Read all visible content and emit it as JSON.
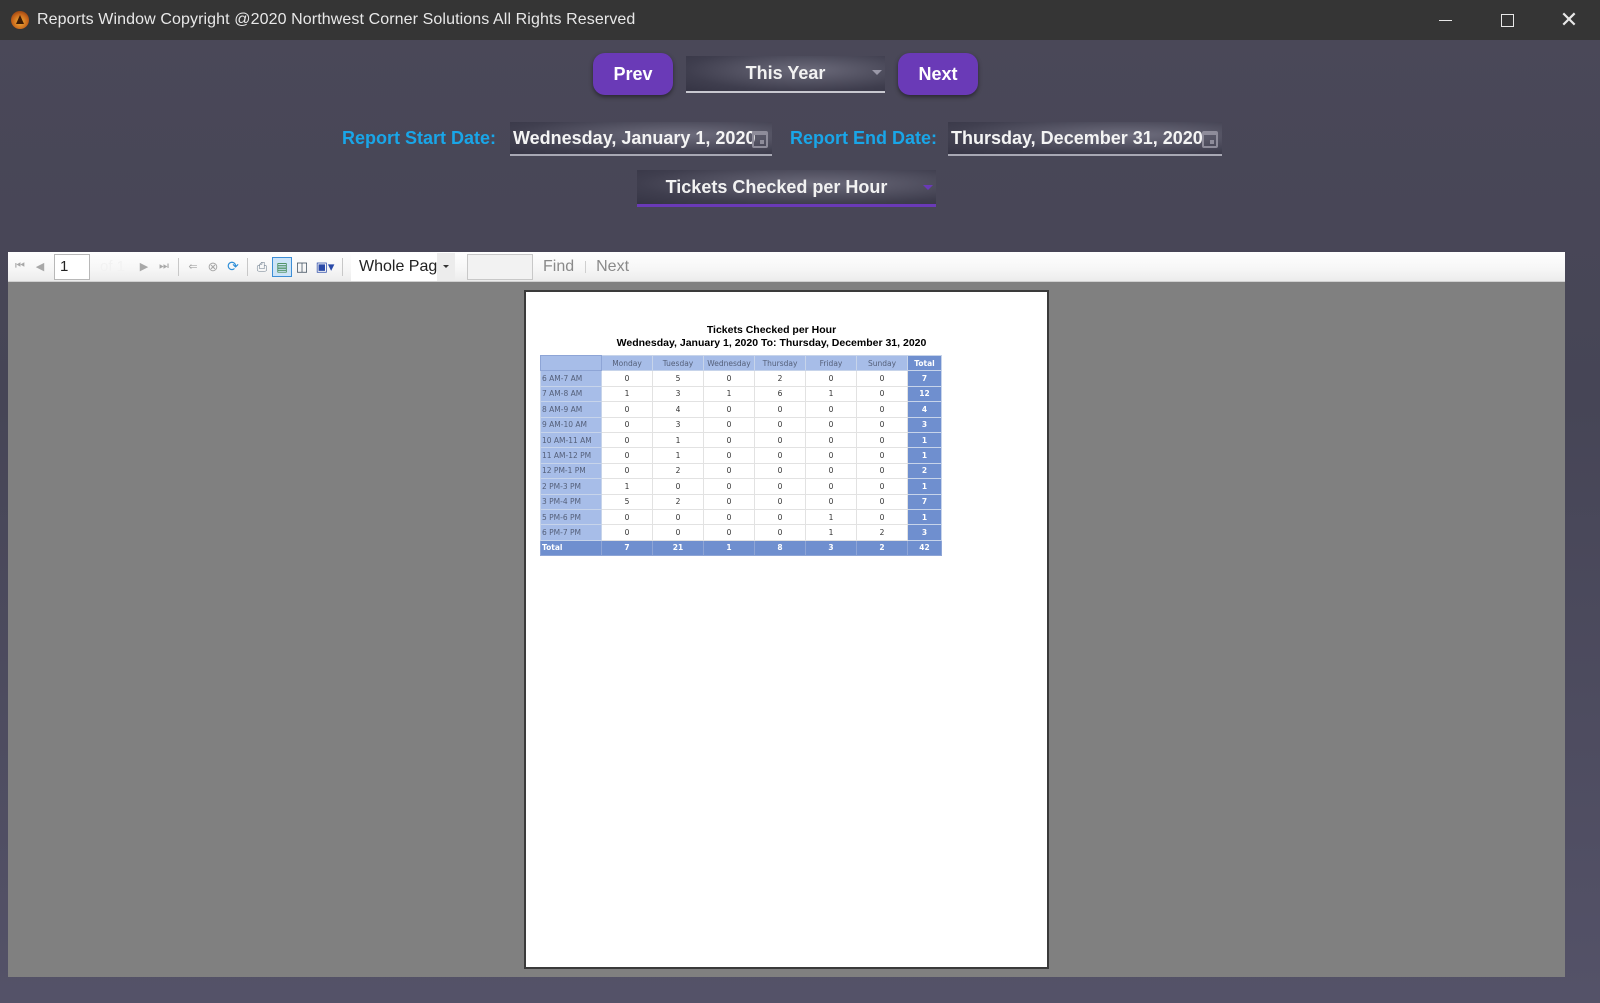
{
  "window": {
    "title": "Reports Window Copyright @2020 Northwest Corner Solutions All Rights Reserved",
    "icon": "app-logo-icon",
    "controls": [
      "minimize-icon",
      "maximize-icon",
      "close-icon"
    ]
  },
  "navigation": {
    "prev_label": "Prev",
    "next_label": "Next",
    "period_selected": "This Year",
    "accent_color": "#6a3ab7"
  },
  "dates": {
    "start_label": "Report Start Date:",
    "start_value": "Wednesday, January 1, 2020",
    "end_label": "Report End Date:",
    "end_value": "Thursday, December 31, 2020",
    "label_color": "#19a6e8"
  },
  "report_selector": {
    "selected": "Tickets Checked per Hour"
  },
  "toolbar": {
    "page_number": "1",
    "page_of": "of 1",
    "zoom_value": "Whole Page",
    "find_value": "",
    "find_label": "Find",
    "find_next_label": "Next",
    "icons": [
      "first-page-icon",
      "previous-page-icon",
      "next-page-icon",
      "last-page-icon",
      "back-icon",
      "stop-icon",
      "refresh-icon",
      "print-icon",
      "print-layout-icon",
      "page-setup-icon",
      "export-icon"
    ]
  },
  "report": {
    "title": "Tickets Checked per Hour",
    "subtitle": "Wednesday, January 1, 2020 To: Thursday, December 31, 2020",
    "columns": [
      "Monday",
      "Tuesday",
      "Wednesday",
      "Thursday",
      "Friday",
      "Sunday"
    ],
    "total_label": "Total",
    "rows": [
      {
        "label": "6 AM-7 AM",
        "values": [
          "0",
          "5",
          "0",
          "2",
          "0",
          "0"
        ],
        "total": "7"
      },
      {
        "label": "7 AM-8 AM",
        "values": [
          "1",
          "3",
          "1",
          "6",
          "1",
          "0"
        ],
        "total": "12"
      },
      {
        "label": "8 AM-9 AM",
        "values": [
          "0",
          "4",
          "0",
          "0",
          "0",
          "0"
        ],
        "total": "4"
      },
      {
        "label": "9 AM-10 AM",
        "values": [
          "0",
          "3",
          "0",
          "0",
          "0",
          "0"
        ],
        "total": "3"
      },
      {
        "label": "10 AM-11 AM",
        "values": [
          "0",
          "1",
          "0",
          "0",
          "0",
          "0"
        ],
        "total": "1"
      },
      {
        "label": "11 AM-12 PM",
        "values": [
          "0",
          "1",
          "0",
          "0",
          "0",
          "0"
        ],
        "total": "1"
      },
      {
        "label": "12 PM-1 PM",
        "values": [
          "0",
          "2",
          "0",
          "0",
          "0",
          "0"
        ],
        "total": "2"
      },
      {
        "label": "2 PM-3 PM",
        "values": [
          "1",
          "0",
          "0",
          "0",
          "0",
          "0"
        ],
        "total": "1"
      },
      {
        "label": "3 PM-4 PM",
        "values": [
          "5",
          "2",
          "0",
          "0",
          "0",
          "0"
        ],
        "total": "7"
      },
      {
        "label": "5 PM-6 PM",
        "values": [
          "0",
          "0",
          "0",
          "0",
          "1",
          "0"
        ],
        "total": "1"
      },
      {
        "label": "6 PM-7 PM",
        "values": [
          "0",
          "0",
          "0",
          "0",
          "1",
          "2"
        ],
        "total": "3"
      }
    ],
    "totals": {
      "label": "Total",
      "values": [
        "7",
        "21",
        "1",
        "8",
        "3",
        "2"
      ],
      "total": "42"
    }
  }
}
